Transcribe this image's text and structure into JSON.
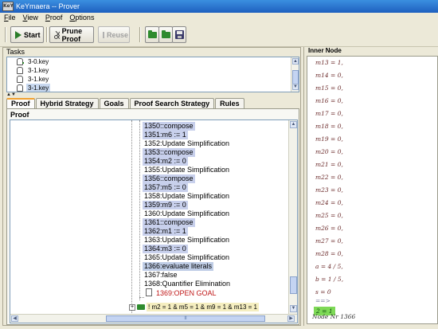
{
  "window": {
    "title": "KeYmaera -- Prover",
    "icon_text": "KeY"
  },
  "menu": {
    "items": [
      {
        "first": "F",
        "rest": "ile"
      },
      {
        "first": "V",
        "rest": "iew"
      },
      {
        "first": "P",
        "rest": "roof"
      },
      {
        "first": "O",
        "rest": "ptions"
      }
    ]
  },
  "toolbar": {
    "start_label": "Start",
    "prune_label": "Prune Proof",
    "reuse_label": "Reuse",
    "icons": [
      "open-folder-icon",
      "open-recent-icon",
      "save-icon"
    ]
  },
  "tasks": {
    "label": "Tasks",
    "items": [
      {
        "label": "3-0.key",
        "selected": false
      },
      {
        "label": "3-1.key",
        "selected": false
      },
      {
        "label": "3-1.key",
        "selected": false
      },
      {
        "label": "3-1.key",
        "selected": true
      }
    ]
  },
  "tabs": [
    "Proof",
    "Hybrid Strategy",
    "Goals",
    "Proof Search Strategy",
    "Rules"
  ],
  "active_tab": "Proof",
  "proof": {
    "label": "Proof",
    "nodes": [
      {
        "text": "1350::compose",
        "style": "hl"
      },
      {
        "text": "1351:m6 := 1",
        "style": "hl"
      },
      {
        "text": "1352:Update Simplification",
        "style": ""
      },
      {
        "text": "1353::compose",
        "style": "hl"
      },
      {
        "text": "1354:m2 := 0",
        "style": "hl"
      },
      {
        "text": "1355:Update Simplification",
        "style": ""
      },
      {
        "text": "1356::compose",
        "style": "hl"
      },
      {
        "text": "1357:m5 := 0",
        "style": "hl"
      },
      {
        "text": "1358:Update Simplification",
        "style": ""
      },
      {
        "text": "1359:m9 := 0",
        "style": "hl"
      },
      {
        "text": "1360:Update Simplification",
        "style": ""
      },
      {
        "text": "1361::compose",
        "style": "hl"
      },
      {
        "text": "1362:m1 := 1",
        "style": "hl"
      },
      {
        "text": "1363:Update Simplification",
        "style": ""
      },
      {
        "text": "1364:m3 := 0",
        "style": "hl"
      },
      {
        "text": "1365:Update Simplification",
        "style": ""
      },
      {
        "text": "1366:evaluate literals",
        "style": "sel"
      },
      {
        "text": "1367:false",
        "style": ""
      },
      {
        "text": "1368:Quantifier Elimination",
        "style": ""
      },
      {
        "text": "1369:OPEN GOAL",
        "style": "open"
      }
    ],
    "branch": "! m2 = 1 & m5 = 1 & m9 = 1 & m13 = 1",
    "scroll_label": "II"
  },
  "inner_node": {
    "label": "Inner Node",
    "lines": [
      "m13 = 1,",
      "m14 = 0,",
      "m15 = 0,",
      "m16 = 0,",
      "m17 = 0,",
      "m18 = 0,",
      "m19 = 0,",
      "m20 = 0,",
      "m21 = 0,",
      "m22 = 0,",
      "m23 = 0,",
      "m24 = 0,",
      "m25 = 0,",
      "m26 = 0,",
      "m27 = 0,",
      "m28 = 0,",
      "a = 4 / 5,",
      "b = 1 / 5,",
      "s = 0"
    ],
    "arrow": "==>",
    "goal": "2 = 1",
    "node_number": "Node Nr 1366"
  },
  "colors": {
    "title_bar": "#1e5fbf",
    "selection": "#bfcde6",
    "open_goal": "#c01818",
    "goal_highlight": "#7ed957",
    "tab_accent": "#f0a030"
  }
}
